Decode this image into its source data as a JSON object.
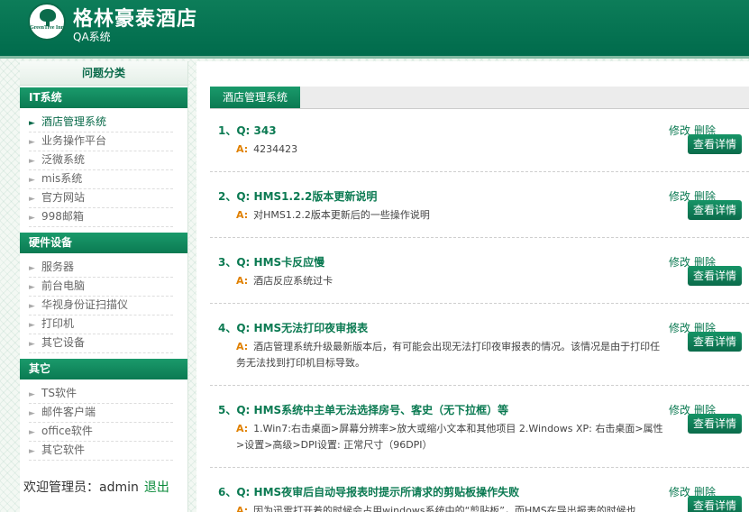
{
  "header": {
    "logo_text": "GreenTree Inn",
    "title": "格林豪泰酒店",
    "subtitle": "QA系统"
  },
  "sidebar": {
    "heading": "问题分类",
    "categories": [
      {
        "title": "IT系统",
        "items": [
          "酒店管理系统",
          "业务操作平台",
          "泛微系统",
          "mis系统",
          "官方网站",
          "998邮箱"
        ],
        "active_index": 0
      },
      {
        "title": "硬件设备",
        "items": [
          "服务器",
          "前台电脑",
          "华视身份证扫描仪",
          "打印机",
          "其它设备"
        ]
      },
      {
        "title": "其它",
        "items": [
          "TS软件",
          "邮件客户端",
          "office软件",
          "其它软件"
        ]
      }
    ],
    "welcome": "欢迎管理员：admin",
    "logout": "退出"
  },
  "main": {
    "tab": "酒店管理系统",
    "edit_label": "修改",
    "delete_label": "删除",
    "detail_label": "查看详情",
    "a_label": "A:",
    "questions": [
      {
        "q": "1、Q: 343",
        "a": "4234423"
      },
      {
        "q": "2、Q: HMS1.2.2版本更新说明",
        "a": "对HMS1.2.2版本更新后的一些操作说明"
      },
      {
        "q": "3、Q: HMS卡反应慢",
        "a": "酒店反应系统过卡"
      },
      {
        "q": "4、Q: HMS无法打印夜审报表",
        "a": "酒店管理系统升级最新版本后，有可能会出现无法打印夜审报表的情况。该情况是由于打印任务无法找到打印机目标导致。"
      },
      {
        "q": "5、Q: HMS系统中主单无法选择房号、客史（无下拉框）等",
        "a": "1.Win7:右击桌面>屏幕分辨率>放大或缩小文本和其他项目 2.Windows XP: 右击桌面>属性>设置>高级>DPI设置: 正常尺寸（96DPI）"
      },
      {
        "q": "6、Q: HMS夜审后自动导报表时提示所请求的剪贴板操作失败",
        "a": "因为迅雷打开着的时候会占用windows系统中的“剪贴板”，而HMS在导出报表的时候也"
      }
    ]
  }
}
